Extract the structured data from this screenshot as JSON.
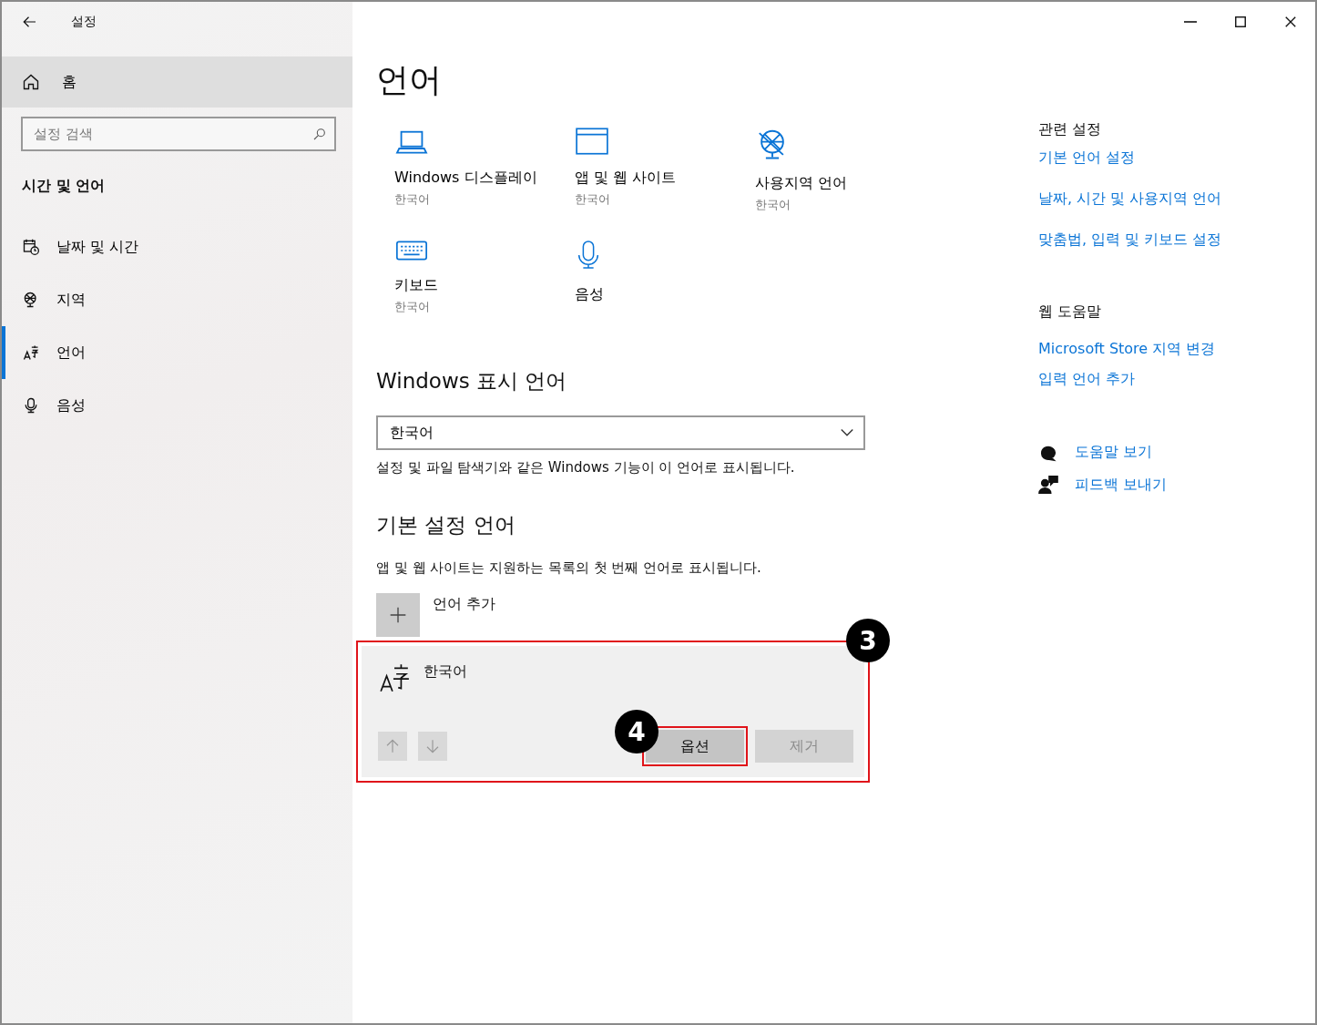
{
  "window": {
    "title": "설정"
  },
  "sidebar": {
    "home": {
      "label": "홈",
      "hovered": true
    },
    "search": {
      "placeholder": "설정 검색"
    },
    "section_title": "시간 및 언어",
    "items": [
      {
        "kind": "datetime",
        "label": "날짜 및 시간",
        "selected": false
      },
      {
        "kind": "region",
        "label": "지역",
        "selected": false
      },
      {
        "kind": "language",
        "label": "언어",
        "selected": true
      },
      {
        "kind": "speech",
        "label": "음성",
        "selected": false
      }
    ]
  },
  "page_title": "언어",
  "tiles": [
    {
      "kind": "display",
      "title": "Windows 디스플레이",
      "subtitle": "한국어"
    },
    {
      "kind": "apps",
      "title": "앱 및 웹 사이트",
      "subtitle": "한국어"
    },
    {
      "kind": "locale",
      "title": "사용지역 언어",
      "subtitle": "한국어"
    },
    {
      "kind": "keyboard",
      "title": "키보드",
      "subtitle": "한국어"
    },
    {
      "kind": "speech",
      "title": "음성"
    }
  ],
  "display_language": {
    "heading": "Windows 표시 언어",
    "dropdown": {
      "value": "한국어"
    },
    "description": "설정 및 파일 탐색기와 같은 Windows 기능이 이 언어로 표시됩니다."
  },
  "preferred_languages": {
    "heading": "기본 설정 언어",
    "description": "앱 및 웹 사이트는 지원하는 목록의 첫 번째 언어로 표시됩니다.",
    "add_label": "언어 추가",
    "languages": [
      {
        "name": "한국어",
        "callout": "3",
        "move_up": {
          "disabled": true
        },
        "move_down": {
          "disabled": true
        },
        "buttons": [
          {
            "label": "옵션",
            "disabled": false,
            "callout": "4"
          },
          {
            "label": "제거",
            "disabled": true
          }
        ]
      }
    ]
  },
  "related": {
    "heading": "관련 설정",
    "links": [
      "기본 언어 설정",
      "날짜, 시간 및 사용지역 언어",
      "맞춤법, 입력 및 키보드 설정"
    ]
  },
  "web_help": {
    "heading": "웹 도움말",
    "links": [
      "Microsoft Store 지역 변경",
      "입력 언어 추가"
    ]
  },
  "help_links": [
    {
      "kind": "help",
      "label": "도움말 보기"
    },
    {
      "kind": "feedback",
      "label": "피드백 보내기"
    }
  ]
}
